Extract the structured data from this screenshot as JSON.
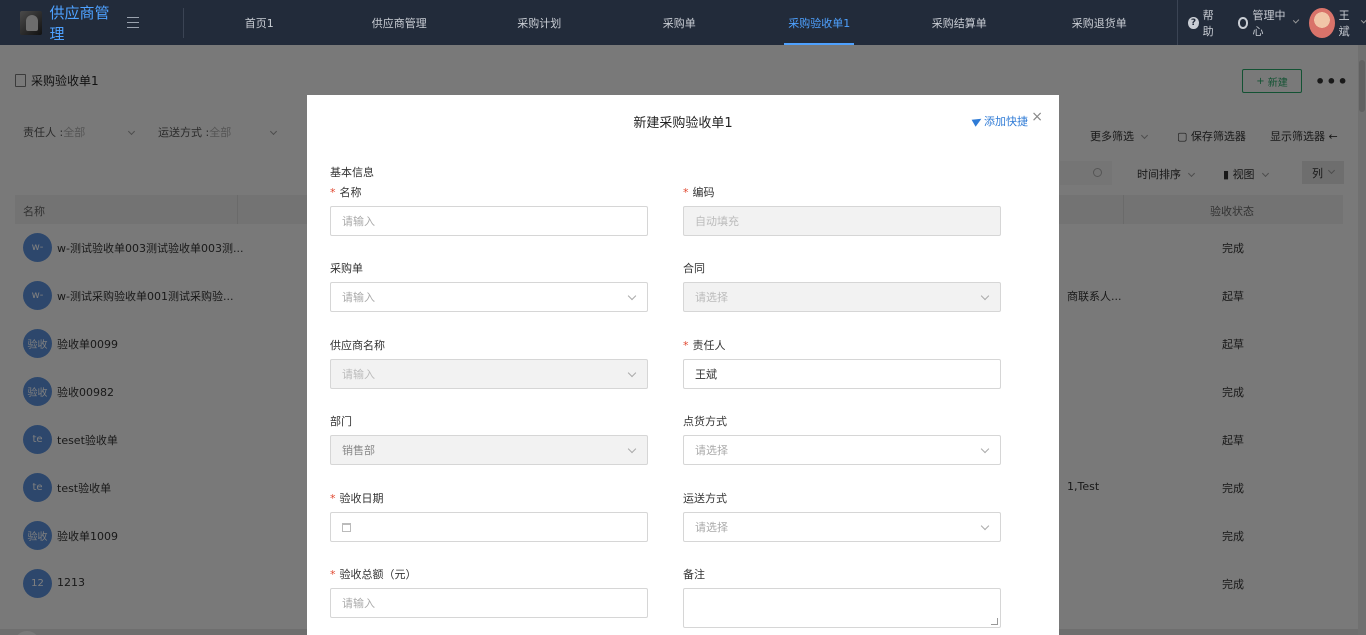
{
  "topnav": {
    "brand": "供应商管理",
    "items": [
      "首页1",
      "供应商管理",
      "采购计划",
      "采购单",
      "采购验收单1",
      "采购结算单",
      "采购退货单"
    ],
    "active_index": 4,
    "help": "帮助",
    "admin": "管理中心",
    "user": "王斌"
  },
  "page": {
    "title": "采购验收单1",
    "new_button": "新建",
    "more": "•••",
    "filters": [
      {
        "label": "责任人 :",
        "value": "全部"
      },
      {
        "label": "运送方式 :",
        "value": "全部"
      }
    ],
    "tools": {
      "more_filter": "更多筛选",
      "save_filter": "保存筛选器",
      "show_filter": "显示筛选器",
      "time_sort": "时间排序",
      "view": "视图",
      "columns": "列"
    },
    "table": {
      "col_name": "名称",
      "col_status": "验收状态",
      "rows": [
        {
          "badge": "w-",
          "name": "w-测试验收单003测试验收单003测...",
          "extra": "",
          "status": "完成"
        },
        {
          "badge": "w-",
          "name": "w-测试采购验收单001测试采购验...",
          "extra": "商联系人...",
          "status": "起草"
        },
        {
          "badge": "验收",
          "name": "验收单0099",
          "extra": "",
          "status": "起草"
        },
        {
          "badge": "验收",
          "name": "验收00982",
          "extra": "",
          "status": "完成"
        },
        {
          "badge": "te",
          "name": "teset验收单",
          "extra": "",
          "status": "起草"
        },
        {
          "badge": "te",
          "name": "test验收单",
          "extra": "1,Test",
          "status": "完成"
        },
        {
          "badge": "验收",
          "name": "验收单1009",
          "extra": "",
          "status": "完成"
        },
        {
          "badge": "12",
          "name": "1213",
          "extra": "",
          "status": "完成"
        }
      ]
    }
  },
  "modal": {
    "title": "新建采购验收单1",
    "quick_add": "添加快捷",
    "close": "×",
    "section": "基本信息",
    "fields": {
      "name": {
        "label": "名称",
        "required": true,
        "placeholder": "请输入"
      },
      "code": {
        "label": "编码",
        "required": true,
        "placeholder": "自动填充"
      },
      "purchase_order": {
        "label": "采购单",
        "placeholder": "请输入"
      },
      "contract": {
        "label": "合同",
        "placeholder": "请选择"
      },
      "supplier": {
        "label": "供应商名称",
        "placeholder": "请输入"
      },
      "owner": {
        "label": "责任人",
        "required": true,
        "value": "王斌"
      },
      "department": {
        "label": "部门",
        "value": "销售部"
      },
      "count_method": {
        "label": "点货方式",
        "placeholder": "请选择"
      },
      "accept_date": {
        "label": "验收日期",
        "required": true
      },
      "shipping": {
        "label": "运送方式",
        "placeholder": "请选择"
      },
      "total": {
        "label": "验收总额（元）",
        "required": true,
        "placeholder": "请输入"
      },
      "remark": {
        "label": "备注"
      }
    }
  },
  "colors": {
    "nav_bg": "#222b3a",
    "accent": "#4ea1ff",
    "green": "#27a567",
    "required": "#e0472f"
  }
}
